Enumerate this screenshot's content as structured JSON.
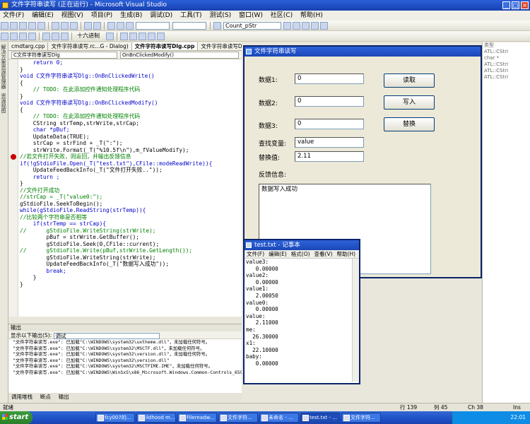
{
  "window": {
    "title": "文件字符串读写 (正在运行) - Microsoft Visual Studio"
  },
  "menu": [
    "文件(F)",
    "编辑(E)",
    "视图(V)",
    "项目(P)",
    "生成(B)",
    "调试(D)",
    "工具(T)",
    "测试(S)",
    "窗口(W)",
    "社区(C)",
    "帮助(H)"
  ],
  "toolbar": {
    "search_text": "Count_pStr",
    "hex_label": "十六进制"
  },
  "left_tabs": [
    "解决方案资源管理器",
    "资源视图"
  ],
  "doc_tabs": [
    "cmdtarg.cpp",
    "文件字符串读写.rc...G - Dialog)",
    "文件字符串读写Dlg.cpp",
    "文件字符串读写Dlg.h"
  ],
  "nav": {
    "class": "C文件字符串读写Dlg",
    "method": "OnBnClickedModify()"
  },
  "code_lines": [
    "    return 0;",
    "}",
    "",
    "void C文件字符串读写Dlg::OnBnClickedWrite()",
    "{",
    "    // TODO: 在此添加控件通知处理程序代码",
    "",
    "}",
    "",
    "void C文件字符串读写Dlg::OnBnClickedModify()",
    "{",
    "    // TODO: 在此添加控件通知处理程序代码",
    "    CString strTemp,strWrite,strCap;",
    "    char *pBuf;",
    "    UpdateData(TRUE);",
    "    strCap = strFind + _T(\":\");",
    "    strWrite.Format(_T(\"%10.5f\\n\"),m_fValueModify);",
    "//若文件打开失败，则返回，并输出反馈信息",
    "if(!gStdioFile.Open(_T(\"test.txt\"),CFile::modeReadWrite)){",
    "    UpdateFeedBackInfo(_T(\"文件打开失败..\"));",
    "    return ;",
    "}",
    "//文件打开成功",
    "//strCap = _T(\"value0:\");",
    "gStdioFile.SeekToBegin();",
    "while(gStdioFile.ReadString(strTemp)){",
    "//比较两个字符串是否相等",
    "    if(strTemp == strCap){",
    "//      gStdioFile.WriteString(strWrite);",
    "        pBuf = strWrite.GetBuffer();",
    "        gStdioFile.Seek(0,CFile::current);",
    "//      gStdioFile.Write(pBuf,strWrite.GetLength());",
    "        gStdioFile.WriteString(strWrite);",
    "",
    "        UpdateFeedBackInfo(_T(\"数据写入成功\"));",
    "        break;",
    "    }",
    "}"
  ],
  "output": {
    "title": "输出",
    "show_label": "显示以下输出(S):",
    "source": "调试",
    "lines": [
      "\"文件字符串读写.exe\": 已加载\"C:\\WINDOWS\\system32\\uxtheme.dll\"，未加载任何符号。",
      "\"文件字符串读写.exe\": 已加载\"C:\\WINDOWS\\system32\\MSCTF.dll\"，未加载任何符号。",
      "\"文件字符串读写.exe\": 已加载\"C:\\WINDOWS\\system32\\version.dll\"，未加载任何符号。",
      "\"文件字符串读写.exe\": 已加载\"C:\\WINDOWS\\system32\\version.dll\"",
      "\"文件字符串读写.exe\": 已加载\"C:\\WINDOWS\\system32\\MSCTFIME.IME\"，未加载任何符号。",
      "\"文件字符串读写.exe\": 已加载\"C:\\WINDOWS\\WinSxS\\x86_Microsoft.Windows.Common-Controls_6595"
    ]
  },
  "bottom_tabs": [
    "调用堆栈",
    "断点",
    "输出"
  ],
  "right_panel": [
    "类型",
    "",
    "ATL::CStri",
    "char *",
    "",
    "ATL::CStri",
    "ATL::CStri",
    "ATL::CStri"
  ],
  "dialog": {
    "title": "文件字符串读写",
    "labels": {
      "data1": "数据1:",
      "data2": "数据2:",
      "data3": "数据3:",
      "find": "查找变量:",
      "replace": "替换值:",
      "feedback": "反馈信息:"
    },
    "values": {
      "data1": "0",
      "data2": "0",
      "data3": "0",
      "find": "value",
      "replace": "2.11",
      "feedback": "数据写入成功"
    },
    "buttons": {
      "read": "读取",
      "write": "写入",
      "replace": "替换"
    }
  },
  "notepad": {
    "title": "test.txt - 记事本",
    "menu": [
      "文件(F)",
      "编辑(E)",
      "格式(O)",
      "查看(V)",
      "帮助(H)"
    ],
    "lines": [
      "value3:",
      "   0.00000",
      "value2:",
      "   0.00000",
      "value1:",
      "   2.00050",
      "value0:",
      "   0.00000",
      "value:",
      "   2.11000",
      "me:",
      "  26.30000",
      "x1:",
      "  22.10000",
      "baby:",
      "   0.00000"
    ]
  },
  "status": {
    "text": "就绪",
    "line": "行 139",
    "col": "列 45",
    "ch": "Ch 38",
    "mode": "Ins"
  },
  "taskbar": {
    "start": "start",
    "items": [
      "fcy007的...",
      "ildhood m...",
      "Filereadw...",
      "文件字符...",
      "未命名 - ...",
      "test.txt - ...",
      "文件字符..."
    ],
    "clock": "22:01"
  }
}
